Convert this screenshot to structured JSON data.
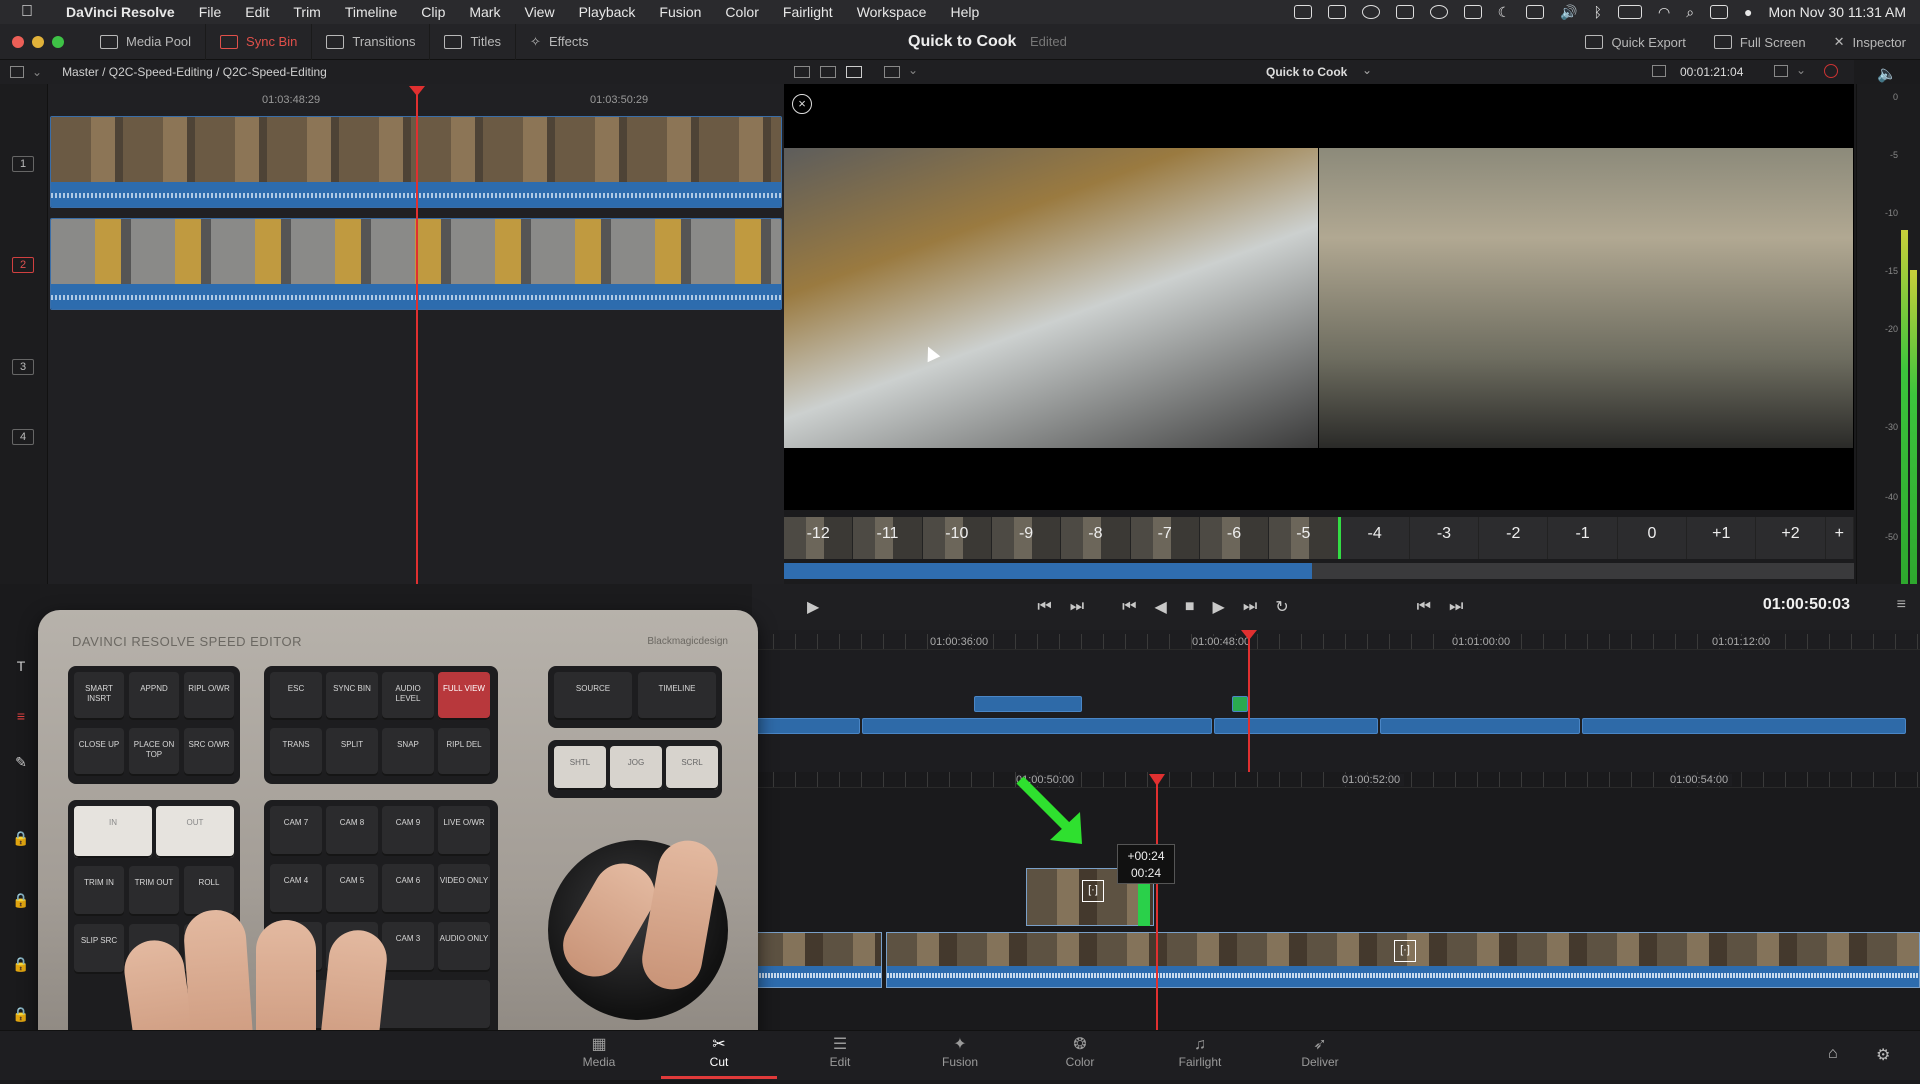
{
  "menubar": {
    "apple": "",
    "items": [
      "DaVinci Resolve",
      "File",
      "Edit",
      "Trim",
      "Timeline",
      "Clip",
      "Mark",
      "View",
      "Playback",
      "Fusion",
      "Color",
      "Fairlight",
      "Workspace",
      "Help"
    ],
    "datetime": "Mon Nov 30  11:31 AM"
  },
  "toolbar": {
    "media_pool": "Media Pool",
    "sync_bin": "Sync Bin",
    "transitions": "Transitions",
    "titles": "Titles",
    "effects": "Effects",
    "project_title": "Quick to Cook",
    "status": "Edited",
    "quick_export": "Quick Export",
    "full_screen": "Full Screen",
    "inspector": "Inspector"
  },
  "source": {
    "path": "Master / Q2C-Speed-Editing / Q2C-Speed-Editing",
    "ruler_left": "01:03:48:29",
    "ruler_right": "01:03:50:29",
    "tracks": [
      "1",
      "2",
      "3",
      "4"
    ]
  },
  "viewer": {
    "timeline_name": "Quick to Cook",
    "duration": "00:01:21:04",
    "close_glyph": "×"
  },
  "frame_strip": [
    "-12",
    "-11",
    "-10",
    "-9",
    "-8",
    "-7",
    "-6",
    "-5",
    "-4",
    "-3",
    "-2",
    "-1",
    "0",
    "+1",
    "+2",
    "+"
  ],
  "meters": {
    "ticks": [
      "0",
      "-5",
      "-10",
      "-15",
      "-20",
      "-30",
      "-40",
      "-50"
    ]
  },
  "transport": {
    "timecode": "01:00:50:03"
  },
  "upper_timeline": {
    "ruler": [
      "01:00:36:00",
      "01:00:48:00",
      "01:01:00:00",
      "01:01:12:00"
    ]
  },
  "lower_timeline": {
    "ruler": [
      "01:00:50:00",
      "01:00:52:00",
      "01:00:54:00"
    ],
    "tooltip_line1": "+00:24",
    "tooltip_line2": "00:24"
  },
  "keyboard": {
    "title": "DAVINCI RESOLVE  SPEED EDITOR",
    "brand": "Blackmagicdesign",
    "keys": {
      "smart_insert": "SMART INSRT",
      "append": "APPND",
      "ripl_owr": "RIPL O/WR",
      "close_up": "CLOSE UP",
      "place_on_top": "PLACE ON TOP",
      "src_owr": "SRC O/WR",
      "esc": "ESC",
      "sync_bin": "SYNC BIN",
      "audio_level": "AUDIO LEVEL",
      "full_view": "FULL VIEW",
      "trans": "TRANS",
      "split": "SPLIT",
      "snap": "SNAP",
      "ripl_del": "RIPL DEL",
      "source": "SOURCE",
      "timeline": "TIMELINE",
      "shtl": "SHTL",
      "jog": "JOG",
      "scrl": "SCRL",
      "in": "IN",
      "out": "OUT",
      "cam7": "CAM 7",
      "cam8": "CAM 8",
      "cam9": "CAM 9",
      "live_owr": "LIVE O/WR",
      "trim_in": "TRIM IN",
      "trim_out": "TRIM OUT",
      "roll": "ROLL",
      "cam4": "CAM 4",
      "cam5": "CAM 5",
      "cam6": "CAM 6",
      "video_only": "VIDEO ONLY",
      "slip_src": "SLIP SRC",
      "cam1": "CAM 1",
      "cam3": "CAM 3",
      "audio_only": "AUDIO ONLY"
    }
  },
  "pagenav": {
    "tabs": [
      {
        "label": "Media",
        "icon": "media-icon"
      },
      {
        "label": "Cut",
        "icon": "cut-icon"
      },
      {
        "label": "Edit",
        "icon": "edit-icon"
      },
      {
        "label": "Fusion",
        "icon": "fusion-icon"
      },
      {
        "label": "Color",
        "icon": "color-icon"
      },
      {
        "label": "Fairlight",
        "icon": "fairlight-icon"
      },
      {
        "label": "Deliver",
        "icon": "deliver-icon"
      }
    ]
  },
  "colors": {
    "accent_red": "#e03a3a",
    "clip_blue": "#2e6aa8",
    "playhead": "#e03030",
    "arrow_green": "#2fe02f"
  }
}
